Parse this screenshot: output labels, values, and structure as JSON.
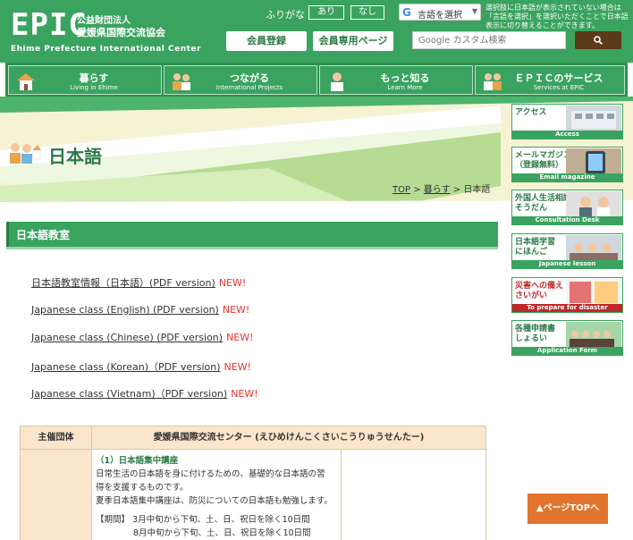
{
  "header": {
    "logo_epic": "EPIC",
    "logo_corp": "公益財団法人",
    "logo_org": "愛媛県国際交流協会",
    "logo_en": "Ehime Prefecture International Center",
    "furigana_label": "ふりがな",
    "furigana_on": "あり",
    "furigana_off": "なし",
    "translate_label": "言語を選択",
    "translate_note": "選択肢に日本語が表示されていない場合は「言語を選択」を選択いただくことで日本語表示に切り替えることができます。",
    "btn_register": "会員登録",
    "btn_member": "会員専用ページ",
    "search_placeholder": "Google カスタム検索"
  },
  "nav": [
    {
      "jp": "暮らす",
      "en": "Living in Ehime"
    },
    {
      "jp": "つながる",
      "en": "International Projects"
    },
    {
      "jp": "もっと知る",
      "en": "Learn More"
    },
    {
      "jp": "ＥＰＩＣのサービス",
      "en": "Services at EPIC"
    }
  ],
  "page": {
    "title": "日本語",
    "breadcrumb": {
      "top": "TOP",
      "sep": ">",
      "mid": "暮らす",
      "current": "日本語"
    }
  },
  "section": {
    "title": "日本語教室"
  },
  "pdf_links": [
    {
      "text": "日本語教室情報（日本語）(PDF version)",
      "badge": "NEW!"
    },
    {
      "text": "Japanese class (English) (PDF version)",
      "badge": "NEW!"
    },
    {
      "text": "Japanese class (Chinese) (PDF version)",
      "badge": "NEW!"
    },
    {
      "text": "Japanese class (Korean)（PDF version)",
      "badge": "NEW!"
    },
    {
      "text": "Japanese class (Vietnam)（PDF version)",
      "badge": "NEW!"
    }
  ],
  "table": {
    "h1": "主催団体",
    "h2": "愛媛県国際交流センター (えひめけんこくさいこうりゅうせんたー)",
    "course": "（1）日本語集中講座",
    "line1": "日常生活の日本語を身に付けるための、基礎的な日本語の習",
    "line2": "得を支援するものです。",
    "line3": "夏季日本語集中講座は、防災についての日本語も勉強します。",
    "line4": "【期間】 3月中旬から下旬、土、日、祝日を除く10日間",
    "line5": "8月中旬から下旬、土、日、祝日を除く10日間"
  },
  "side": [
    {
      "label": "アクセス",
      "cap": "Access"
    },
    {
      "label": "メールマガジン\n（登録無料）",
      "cap": "Email magazine"
    },
    {
      "label": "外国人生活相談\nそうだん",
      "cap": "Consultation Desk"
    },
    {
      "label": "日本語学習\nにほんご",
      "cap": "Japanese lesson"
    },
    {
      "label": "災害への備え\nさいがい",
      "cap": "To prepare for disaster"
    },
    {
      "label": "各種申請書\nしょるい",
      "cap": "Application Form"
    }
  ],
  "pagetop": "▲ページTOPへ"
}
